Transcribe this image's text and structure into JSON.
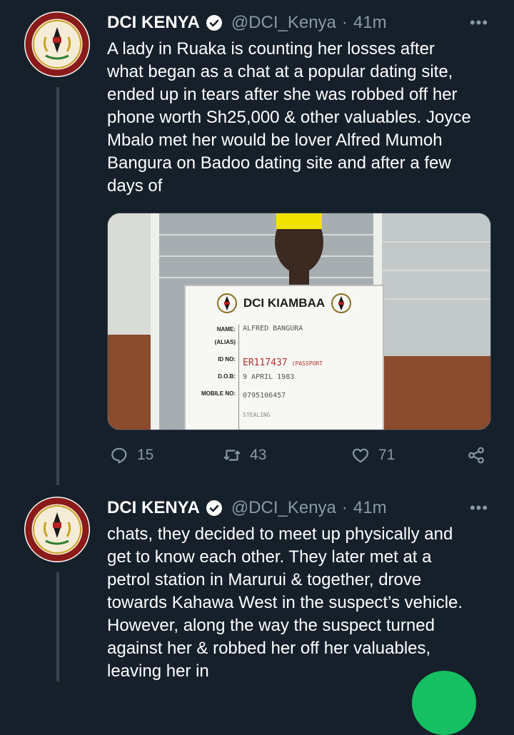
{
  "tweets": [
    {
      "author_name": "DCI KENYA",
      "handle": "@DCI_Kenya",
      "separator": "·",
      "time": "41m",
      "text": "A lady in Ruaka is counting her losses after\nwhat began as a chat at a popular dating site,\nended up in tears after she was robbed off her\nphone worth Sh25,000 & other valuables. Joyce\nMbalo met her would be lover Alfred Mumoh\nBangura on Badoo dating site and after a few\ndays of",
      "media": {
        "board_title": "DCI KIAMBAA",
        "form_labels": [
          "NAME:",
          "(ALIAS)",
          "ID NO:",
          "D.O.B:",
          "MOBILE NO:"
        ],
        "name_value": "ALFRED BANGURA",
        "id_value": "ER117437",
        "id_note": "(PASSPORT",
        "dob_value": "9 APRIL 1983",
        "mobile_value": "0795106457",
        "offence_value": "STEALING"
      },
      "replies": "15",
      "retweets": "43",
      "likes": "71"
    },
    {
      "author_name": "DCI KENYA",
      "handle": "@DCI_Kenya",
      "separator": "·",
      "time": "41m",
      "text": "chats, they decided to meet up physically and\nget to know each other. They later met at a\npetrol station in Marurui & together, drove\ntowards Kahawa West in the suspect’s vehicle.\nHowever, along the way the suspect turned\nagainst her & robbed her off her valuables,\nleaving her in"
    }
  ],
  "colors": {
    "background": "#15202b",
    "secondary_text": "#8899a6",
    "divider": "#38444d",
    "verified_badge": "#ffffff",
    "fab": "#17bf63"
  },
  "icons": [
    "verified-badge-icon",
    "more-options-icon",
    "reply-icon",
    "retweet-icon",
    "like-icon",
    "share-icon"
  ]
}
